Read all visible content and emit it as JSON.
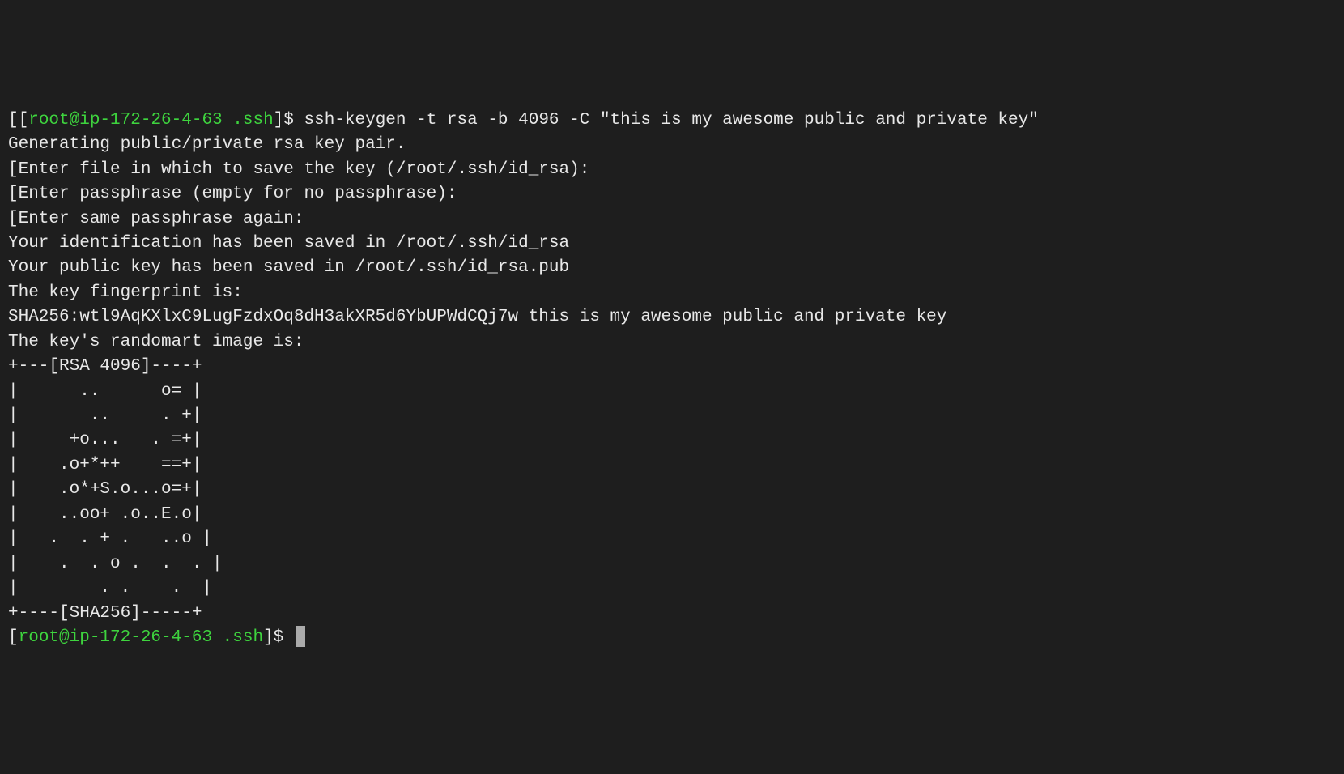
{
  "terminal": {
    "prompt1": {
      "bracket_open": "[[",
      "userhost": "root@ip-172-26-4-63 .ssh",
      "bracket_close": "]$ ",
      "command": "ssh-keygen -t rsa -b 4096 -C \"this is my awesome public and private key\""
    },
    "lines": [
      "Generating public/private rsa key pair.",
      "[Enter file in which to save the key (/root/.ssh/id_rsa):",
      "[Enter passphrase (empty for no passphrase):",
      "[Enter same passphrase again:",
      "Your identification has been saved in /root/.ssh/id_rsa",
      "Your public key has been saved in /root/.ssh/id_rsa.pub",
      "The key fingerprint is:",
      "SHA256:wtl9AqKXlxC9LugFzdxOq8dH3akXR5d6YbUPWdCQj7w this is my awesome public and private key",
      "The key's randomart image is:",
      "+---[RSA 4096]----+",
      "|      ..      o= |",
      "|       ..     . +|",
      "|     +o...   . =+|",
      "|    .o+*++    ==+|",
      "|    .o*+S.o...o=+|",
      "|    ..oo+ .o..E.o|",
      "|   .  . + .   ..o |",
      "|    .  . o .  .  . |",
      "|        . .    .  |",
      "+----[SHA256]-----+"
    ],
    "prompt2": {
      "bracket_open": "[",
      "userhost": "root@ip-172-26-4-63 .ssh",
      "bracket_close": "]$ "
    }
  }
}
